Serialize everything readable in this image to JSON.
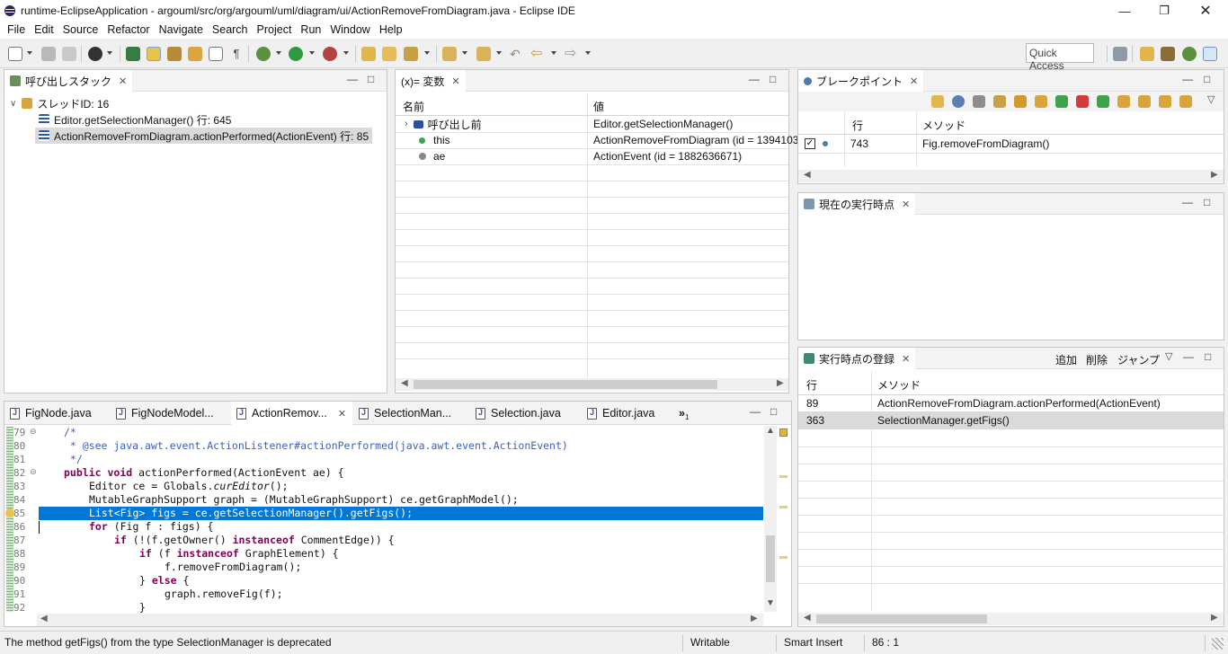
{
  "window": {
    "title": "runtime-EclipseApplication - argouml/src/org/argouml/uml/diagram/ui/ActionRemoveFromDiagram.java - Eclipse IDE"
  },
  "menu": [
    "File",
    "Edit",
    "Source",
    "Refactor",
    "Navigate",
    "Search",
    "Project",
    "Run",
    "Window",
    "Help"
  ],
  "toolbar": {
    "quick_access": "Quick Access"
  },
  "callstack": {
    "tab": "呼び出しスタック",
    "thread": "スレッドID: 16",
    "frames": [
      "Editor.getSelectionManager() 行: 645",
      "ActionRemoveFromDiagram.actionPerformed(ActionEvent) 行: 85"
    ]
  },
  "variables": {
    "tab": "(x)= 変数",
    "col_name": "名前",
    "col_value": "値",
    "rows": [
      {
        "name": "呼び出し前",
        "value": "Editor.getSelectionManager()"
      },
      {
        "name": "this",
        "value": "ActionRemoveFromDiagram (id = 1394103"
      },
      {
        "name": "ae",
        "value": "ActionEvent (id = 1882636671)"
      }
    ]
  },
  "breakpoints": {
    "tab": "ブレークポイント",
    "col_line": "行",
    "col_method": "メソッド",
    "rows": [
      {
        "line": "743",
        "method": "Fig.removeFromDiagram()"
      }
    ]
  },
  "current_point": {
    "tab": "現在の実行時点"
  },
  "registered_points": {
    "tab": "実行時点の登録",
    "actions": [
      "追加",
      "削除",
      "ジャンプ"
    ],
    "col_line": "行",
    "col_method": "メソッド",
    "rows": [
      {
        "line": "89",
        "method": "ActionRemoveFromDiagram.actionPerformed(ActionEvent)"
      },
      {
        "line": "363",
        "method": "SelectionManager.getFigs()"
      }
    ]
  },
  "editor": {
    "tabs": [
      "FigNode.java",
      "FigNodeModel...",
      "ActionRemov...",
      "SelectionMan...",
      "Selection.java",
      "Editor.java"
    ],
    "overflow": "»",
    "overflow_count": "1",
    "lines": [
      {
        "n": "79"
      },
      {
        "n": "80"
      },
      {
        "n": "81"
      },
      {
        "n": "82"
      },
      {
        "n": "83"
      },
      {
        "n": "84"
      },
      {
        "n": "85"
      },
      {
        "n": "86"
      },
      {
        "n": "87"
      },
      {
        "n": "88"
      },
      {
        "n": "89"
      },
      {
        "n": "90"
      },
      {
        "n": "91"
      },
      {
        "n": "92"
      }
    ],
    "code": {
      "l79": "/*",
      "l80": " * @see java.awt.event.ActionListener#actionPerformed(java.awt.event.ActionEvent)",
      "l81": " */",
      "l82a": "public",
      "l82b": "void",
      "l82c": " actionPerformed(ActionEvent ae) {",
      "l83a": "Editor ce = Globals.",
      "l83b": "curEditor",
      "l83c": "();",
      "l84": "MutableGraphSupport graph = (MutableGraphSupport) ce.getGraphModel();",
      "l85": "List<Fig> figs = ce.getSelectionManager().getFigs();",
      "l86a": "for",
      "l86b": " (Fig f : figs) {",
      "l87a": "if",
      "l87b": " (!(f.getOwner() ",
      "l87c": "instanceof",
      "l87d": " CommentEdge)) {",
      "l88a": "if",
      "l88b": " (f ",
      "l88c": "instanceof",
      "l88d": " GraphElement) {",
      "l89": "f.removeFromDiagram();",
      "l90a": "} ",
      "l90b": "else",
      "l90c": " {",
      "l91": "graph.removeFig(f);",
      "l92": "}"
    }
  },
  "status": {
    "message": "The method getFigs() from the type SelectionManager is deprecated",
    "mode": "Writable",
    "insert": "Smart Insert",
    "position": "86 : 1"
  },
  "colors": {
    "selection": "#0078d7",
    "keyword": "#7f0055",
    "comment": "#3f5fbf"
  }
}
